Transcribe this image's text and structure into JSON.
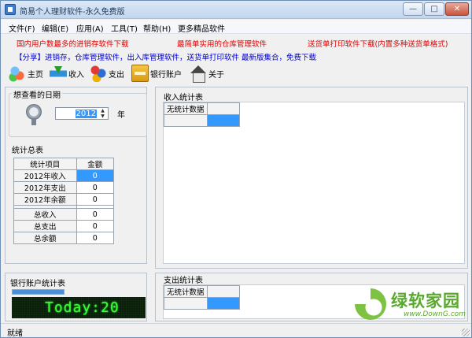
{
  "window": {
    "title": "简易个人理财软件-永久免费版",
    "min_glyph": "—",
    "max_glyph": "□",
    "close_glyph": "✕"
  },
  "menu": {
    "items": [
      {
        "label": "文件(F)"
      },
      {
        "label": "编辑(E)"
      },
      {
        "label": "应用(A)"
      },
      {
        "label": "工具(T)"
      },
      {
        "label": "帮助(H)"
      },
      {
        "label": "更多精品软件"
      }
    ]
  },
  "ads": {
    "line1": [
      {
        "text": "国内用户数最多的进销存软件下载",
        "color": "red"
      },
      {
        "text": "最简单实用的仓库管理软件",
        "color": "red"
      },
      {
        "text": "送货单打印软件下载(内置多种送货单格式)",
        "color": "red"
      }
    ],
    "line2": "【分享】进销存，仓库管理软件，出入库管理软件，送货单打印软件 最新版集合，免费下载"
  },
  "toolbar": {
    "home": "主页",
    "income": "收入",
    "expense": "支出",
    "bank": "银行账户",
    "about": "关于"
  },
  "date_panel": {
    "label": "想查看的日期",
    "year_value": "2012",
    "year_unit": "年"
  },
  "summary": {
    "title": "统计总表",
    "headers": [
      "统计项目",
      "金额"
    ],
    "rows": [
      {
        "item": "2012年收入",
        "amount": "0"
      },
      {
        "item": "2012年支出",
        "amount": "0"
      },
      {
        "item": "2012年余额",
        "amount": "0"
      },
      {
        "item": "总收入",
        "amount": "0"
      },
      {
        "item": "总支出",
        "amount": "0"
      },
      {
        "item": "总余额",
        "amount": "0"
      }
    ]
  },
  "bank_panel": {
    "title": "银行账户统计表",
    "progress_fraction": 1.0,
    "led_text": "Today:20"
  },
  "income_panel": {
    "title": "收入统计表",
    "no_data": "无统计数据"
  },
  "expense_panel": {
    "title": "支出统计表",
    "no_data": "无统计数据"
  },
  "status": {
    "text": "就绪"
  },
  "watermark": {
    "brand": "绿软家园",
    "url": "www.DownG.com"
  },
  "colors": {
    "selection": "#3399ff",
    "ad_red": "#e00000",
    "ad_blue": "#0000cc",
    "led_green": "#3cff3c"
  }
}
